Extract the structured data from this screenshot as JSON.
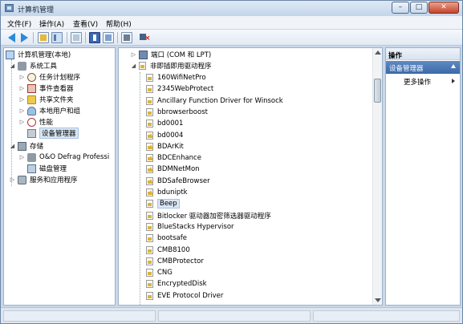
{
  "window": {
    "title": "计算机管理"
  },
  "menu": {
    "file": "文件(F)",
    "action": "操作(A)",
    "view": "查看(V)",
    "help": "帮助(H)"
  },
  "left_tree": {
    "root": "计算机管理(本地)",
    "system_tools": "系统工具",
    "task_scheduler": "任务计划程序",
    "event_viewer": "事件查看器",
    "shared_folders": "共享文件夹",
    "local_users": "本地用户和组",
    "performance": "性能",
    "device_manager": "设备管理器",
    "storage": "存储",
    "defrag": "O&O Defrag Professi",
    "disk_management": "磁盘管理",
    "services_apps": "服务和应用程序"
  },
  "device_list": {
    "ports": "端口 (COM 和 LPT)",
    "non_pnp": "非即插即用驱动程序",
    "items": [
      "160WifiNetPro",
      "2345WebProtect",
      "Ancillary Function Driver for Winsock",
      "bbrowserboost",
      "bd0001",
      "bd0004",
      "BDArKit",
      "BDCEnhance",
      "BDMNetMon",
      "BDSafeBrowser",
      "bduniptk",
      "Beep",
      "Bitlocker 驱动器加密筛选器驱动程序",
      "BlueStacks Hypervisor",
      "bootsafe",
      "CMB8100",
      "CMBProtector",
      "CNG",
      "EncryptedDisk",
      "EVE Protocol Driver"
    ]
  },
  "actions": {
    "header": "操作",
    "section": "设备管理器",
    "more": "更多操作"
  }
}
